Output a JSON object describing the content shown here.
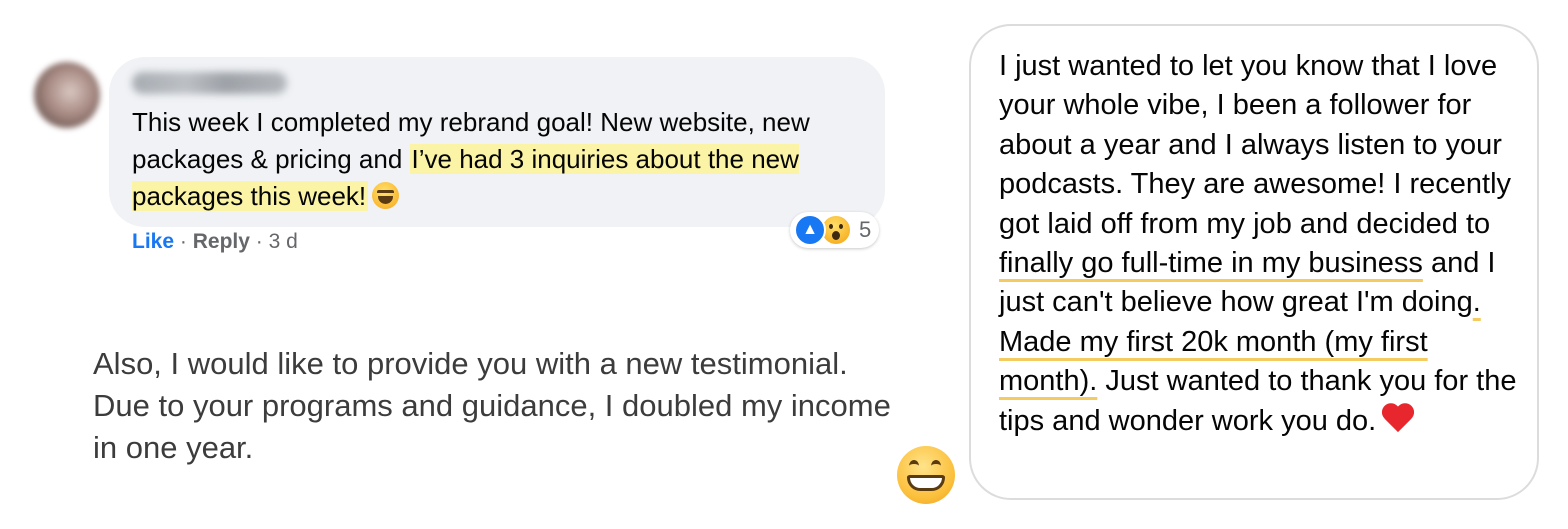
{
  "comment": {
    "author": "Sunnie Ward",
    "text_before_highlight": "This week I completed my rebrand goal! New website, new packages & pricing and ",
    "text_highlight": "I’ve had 3 inquiries about the new packages this week!",
    "like_label": "Like",
    "separator": "·",
    "reply_label": "Reply",
    "time": "3 d",
    "reactions": [
      "like-icon",
      "wow-icon"
    ],
    "reaction_count": "5"
  },
  "testimonial": {
    "text": "Also, I would like to provide you with a new testimonial. Due to your programs and guidance, I doubled my income in one year."
  },
  "message": {
    "avatar_icon": "grinning-face-icon",
    "part1": "I just wanted to let you know that I love your whole vibe, I been a follower for about a year and I always listen to your podcasts. They are awesome! I recently got laid off from my job and decided to ",
    "underline1": "finally go full-time in my business",
    "part2": " and I just can't believe how great I'm doing",
    "underline2": ". Made my first 20k month (my first month).",
    "part3": " Just wanted to thank you for the tips and wonder work you do.",
    "end_icon": "red-heart-icon"
  },
  "colors": {
    "highlight": "#fbf4a6",
    "underline": "#f3cb60",
    "link_blue": "#1877f2",
    "bubble_bg": "#f0f2f5"
  }
}
